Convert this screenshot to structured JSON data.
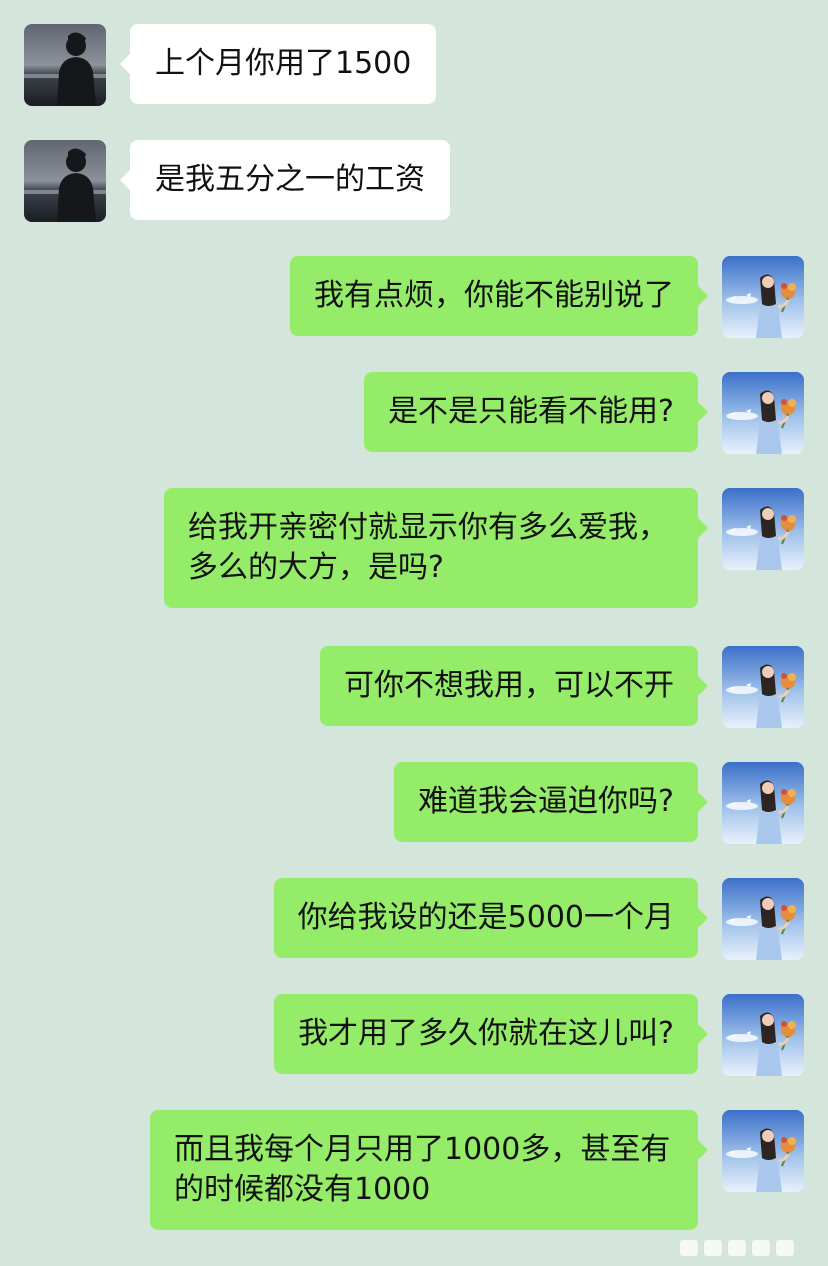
{
  "chat": {
    "colors": {
      "background": "#d4e6dc",
      "incoming_bubble": "#ffffff",
      "outgoing_bubble": "#95ec69",
      "text": "#111111"
    },
    "contact_avatar_icon": "man-silhouette-at-sea-avatar",
    "self_avatar_icon": "girl-with-flowers-by-sea-avatar",
    "messages": [
      {
        "side": "left",
        "text": "上个月你用了1500"
      },
      {
        "side": "left",
        "text": "是我五分之一的工资"
      },
      {
        "side": "right",
        "text": "我有点烦，你能不能别说了"
      },
      {
        "side": "right",
        "text": "是不是只能看不能用?"
      },
      {
        "side": "right",
        "text": "给我开亲密付就显示你有多么爱我，多么的大方，是吗?"
      },
      {
        "side": "right",
        "text": "可你不想我用，可以不开"
      },
      {
        "side": "right",
        "text": "难道我会逼迫你吗?"
      },
      {
        "side": "right",
        "text": "你给我设的还是5000一个月"
      },
      {
        "side": "right",
        "text": "我才用了多久你就在这儿叫?"
      },
      {
        "side": "right",
        "text": "而且我每个月只用了1000多，甚至有的时候都没有1000"
      }
    ]
  }
}
